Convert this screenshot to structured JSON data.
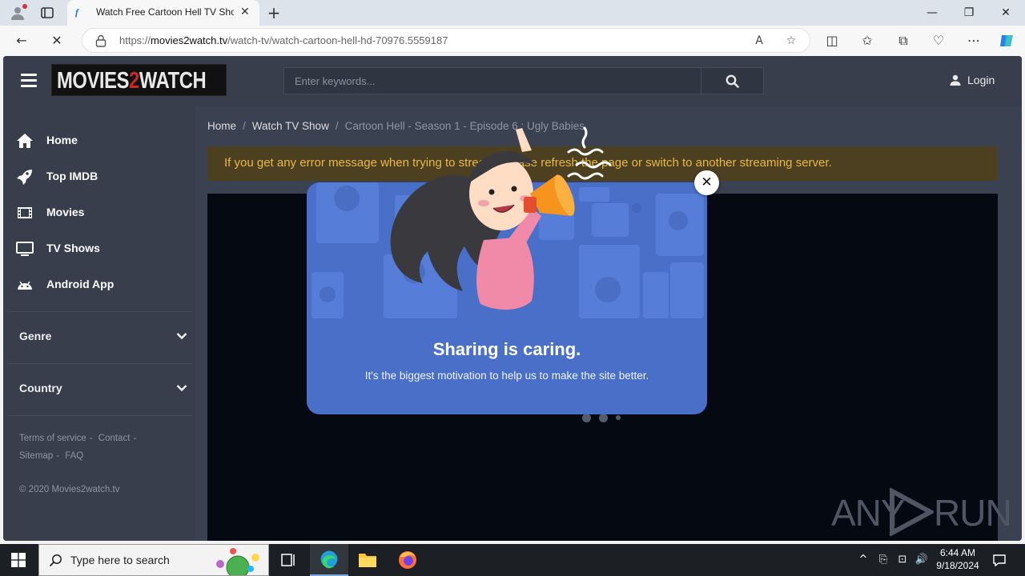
{
  "browser": {
    "tab_title": "Watch Free Cartoon Hell TV Show",
    "tab_favicon": "f",
    "url_prefix": "https://",
    "url_domain": "movies2watch.tv",
    "url_path": "/watch-tv/watch-cartoon-hell-hd-70976.5559187"
  },
  "site": {
    "logo_left": "MOVIES",
    "logo_mid": "2",
    "logo_right": "WATCH",
    "search_placeholder": "Enter keywords...",
    "login_label": "Login"
  },
  "sidebar": {
    "items": [
      {
        "label": "Home",
        "icon": "home-icon"
      },
      {
        "label": "Top IMDB",
        "icon": "rocket-icon"
      },
      {
        "label": "Movies",
        "icon": "film-icon"
      },
      {
        "label": "TV Shows",
        "icon": "tv-icon"
      },
      {
        "label": "Android App",
        "icon": "android-icon"
      }
    ],
    "genre_label": "Genre",
    "country_label": "Country",
    "footer": {
      "terms": "Terms of service",
      "contact": "Contact",
      "sitemap": "Sitemap",
      "faq": "FAQ",
      "sep": "-",
      "copyright": "© 2020 Movies2watch.tv"
    }
  },
  "content": {
    "breadcrumbs": [
      "Home",
      "Watch TV Show",
      "Cartoon Hell - Season 1 - Episode 6 : Ugly Babies"
    ],
    "breadcrumb_sep": "/",
    "notice": "If you get any error message when trying to stream, please refresh the page or switch to another streaming server."
  },
  "modal": {
    "title": "Sharing is caring.",
    "subtitle": "It's the biggest motivation to help us to make the site better.",
    "close_glyph": "✕"
  },
  "watermark": {
    "text_left": "ANY",
    "text_right": "RUN"
  },
  "taskbar": {
    "search_placeholder": "Type here to search",
    "time": "6:44 AM",
    "date": "9/18/2024"
  },
  "colors": {
    "page_bg": "#3a4150",
    "notice_bg": "#4d4020",
    "notice_text": "#e8b848",
    "modal_bg": "#4a6fc8",
    "player_bg": "#050912"
  }
}
